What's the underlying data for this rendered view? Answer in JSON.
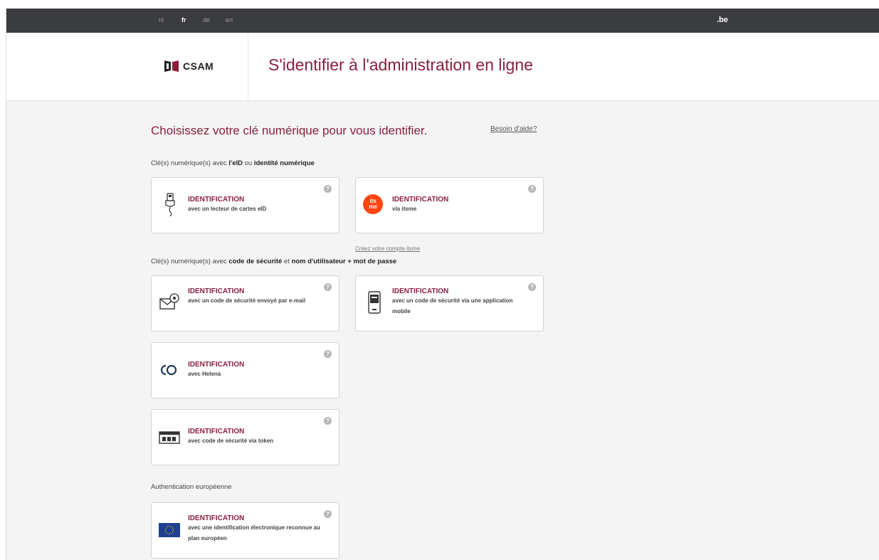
{
  "topbar": {
    "languages": [
      {
        "code": "nl",
        "active": false
      },
      {
        "code": "fr",
        "active": true
      },
      {
        "code": "de",
        "active": false
      },
      {
        "code": "en",
        "active": false
      }
    ],
    "domain": ".be"
  },
  "header": {
    "logo_text": "CSAM",
    "title": "S'identifier à l'administration en ligne"
  },
  "main": {
    "title": "Choisissez votre clé numérique pour vous identifier.",
    "help_link": "Besoin d'aide?",
    "itsme_link": "Créez votre compte itsme"
  },
  "sections": [
    {
      "pre": "Clé(s) numérique(s) avec ",
      "b1": "l'eID",
      "mid": " ou ",
      "b2": "identité numérique",
      "mid2": "",
      "b3": ""
    },
    {
      "pre": "Clé(s) numérique(s) avec ",
      "b1": "code de sécurité",
      "mid": " et ",
      "b2": "nom d'utilisateur + mot de passe",
      "mid2": "",
      "b3": ""
    },
    {
      "pre": "Authentication européenne"
    }
  ],
  "cards": [
    {
      "title": "IDENTIFICATION",
      "subtitle": "avec un lecteur de cartes eID",
      "icon": "card-reader-icon",
      "help": "?"
    },
    {
      "title": "IDENTIFICATION",
      "subtitle": "via itsme",
      "icon": "itsme-logo",
      "icon_text": "its me",
      "help": "?"
    },
    {
      "title": "IDENTIFICATION",
      "subtitle": "avec un code de sécurité envoyé par e-mail",
      "icon": "email-icon",
      "help": "?"
    },
    {
      "title": "IDENTIFICATION",
      "subtitle": "avec un code de sécurité via une application mobile",
      "icon": "mobile-app-icon",
      "help": "?"
    },
    {
      "title": "IDENTIFICATION",
      "subtitle": "avec Helena",
      "icon": "helena-icon",
      "help": "?"
    },
    {
      "title": "IDENTIFICATION",
      "subtitle": "avec code de sécurité via token",
      "icon": "token-icon",
      "help": "?"
    },
    {
      "title": "IDENTIFICATION",
      "subtitle": "avec une identification électronique reconnue au plan européen",
      "icon": "eu-flag-icon",
      "help": "?"
    }
  ],
  "colors": {
    "accent": "#8a1f3d",
    "topbar": "#3b3c3f",
    "arrow": "#e8141b",
    "itsme": "#ff4612",
    "eu_blue": "#1d3f94"
  }
}
